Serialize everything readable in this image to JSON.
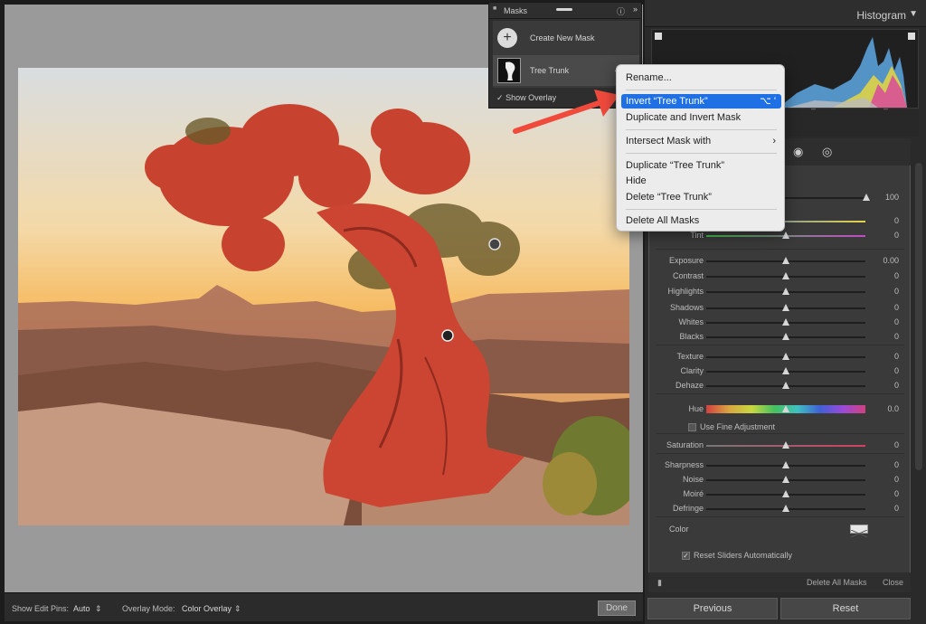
{
  "masks_panel": {
    "title": "Masks",
    "create_new_label": "Create New Mask",
    "mask_name": "Tree Trunk",
    "show_overlay_label": "Show Overlay",
    "help_icon": "help-icon",
    "collapse_icon": "double-chevron-icon"
  },
  "context_menu": {
    "items": [
      {
        "label": "Rename..."
      },
      {
        "label": "Invert “Tree Trunk”",
        "shortcut": "⌥ '"
      },
      {
        "label": "Duplicate and Invert Mask"
      },
      {
        "label": "Intersect Mask with",
        "submenu": "›"
      },
      {
        "label": "Duplicate “Tree Trunk”"
      },
      {
        "label": "Hide"
      },
      {
        "label": "Delete “Tree Trunk”"
      },
      {
        "label": "Delete All Masks"
      }
    ],
    "highlighted_index": 1
  },
  "histogram": {
    "title": "Histogram",
    "arrow": "▼",
    "under_dashes": [
      "–",
      "–"
    ]
  },
  "adjustments": {
    "amount_value": "100",
    "sliders": [
      {
        "label": "Tint",
        "value": "0",
        "pos": 0.5
      },
      {
        "label": "Exposure",
        "value": "0.00",
        "pos": 0.5
      },
      {
        "label": "Contrast",
        "value": "0",
        "pos": 0.5
      },
      {
        "label": "Highlights",
        "value": "0",
        "pos": 0.5
      },
      {
        "label": "Shadows",
        "value": "0",
        "pos": 0.5
      },
      {
        "label": "Whites",
        "value": "0",
        "pos": 0.5
      },
      {
        "label": "Blacks",
        "value": "0",
        "pos": 0.5
      },
      {
        "label": "Texture",
        "value": "0",
        "pos": 0.5
      },
      {
        "label": "Clarity",
        "value": "0",
        "pos": 0.5
      },
      {
        "label": "Dehaze",
        "value": "0",
        "pos": 0.5
      },
      {
        "label": "Hue",
        "value": "0.0",
        "pos": 0.5
      },
      {
        "label": "Saturation",
        "value": "0",
        "pos": 0.5
      },
      {
        "label": "Sharpness",
        "value": "0",
        "pos": 0.5
      },
      {
        "label": "Noise",
        "value": "0",
        "pos": 0.5
      },
      {
        "label": "Moiré",
        "value": "0",
        "pos": 0.5
      },
      {
        "label": "Defringe",
        "value": "0",
        "pos": 0.5
      }
    ],
    "temp_value": "0",
    "use_fine_adjustment_label": "Use Fine Adjustment",
    "color_label": "Color",
    "reset_sliders_label": "Reset Sliders Automatically"
  },
  "panel_footer": {
    "delete_all_label": "Delete All Masks",
    "close_label": "Close"
  },
  "buttons": {
    "previous": "Previous",
    "reset": "Reset"
  },
  "bottom_bar": {
    "show_edit_pins_label": "Show Edit Pins:",
    "show_edit_pins_value": "Auto",
    "overlay_mode_label": "Overlay Mode:",
    "overlay_mode_value": "Color Overlay",
    "done_label": "Done"
  },
  "colors": {
    "overlay_red": "#d8402e",
    "menu_highlight": "#1f6fe5",
    "arrow_red": "#ef4a3c"
  }
}
